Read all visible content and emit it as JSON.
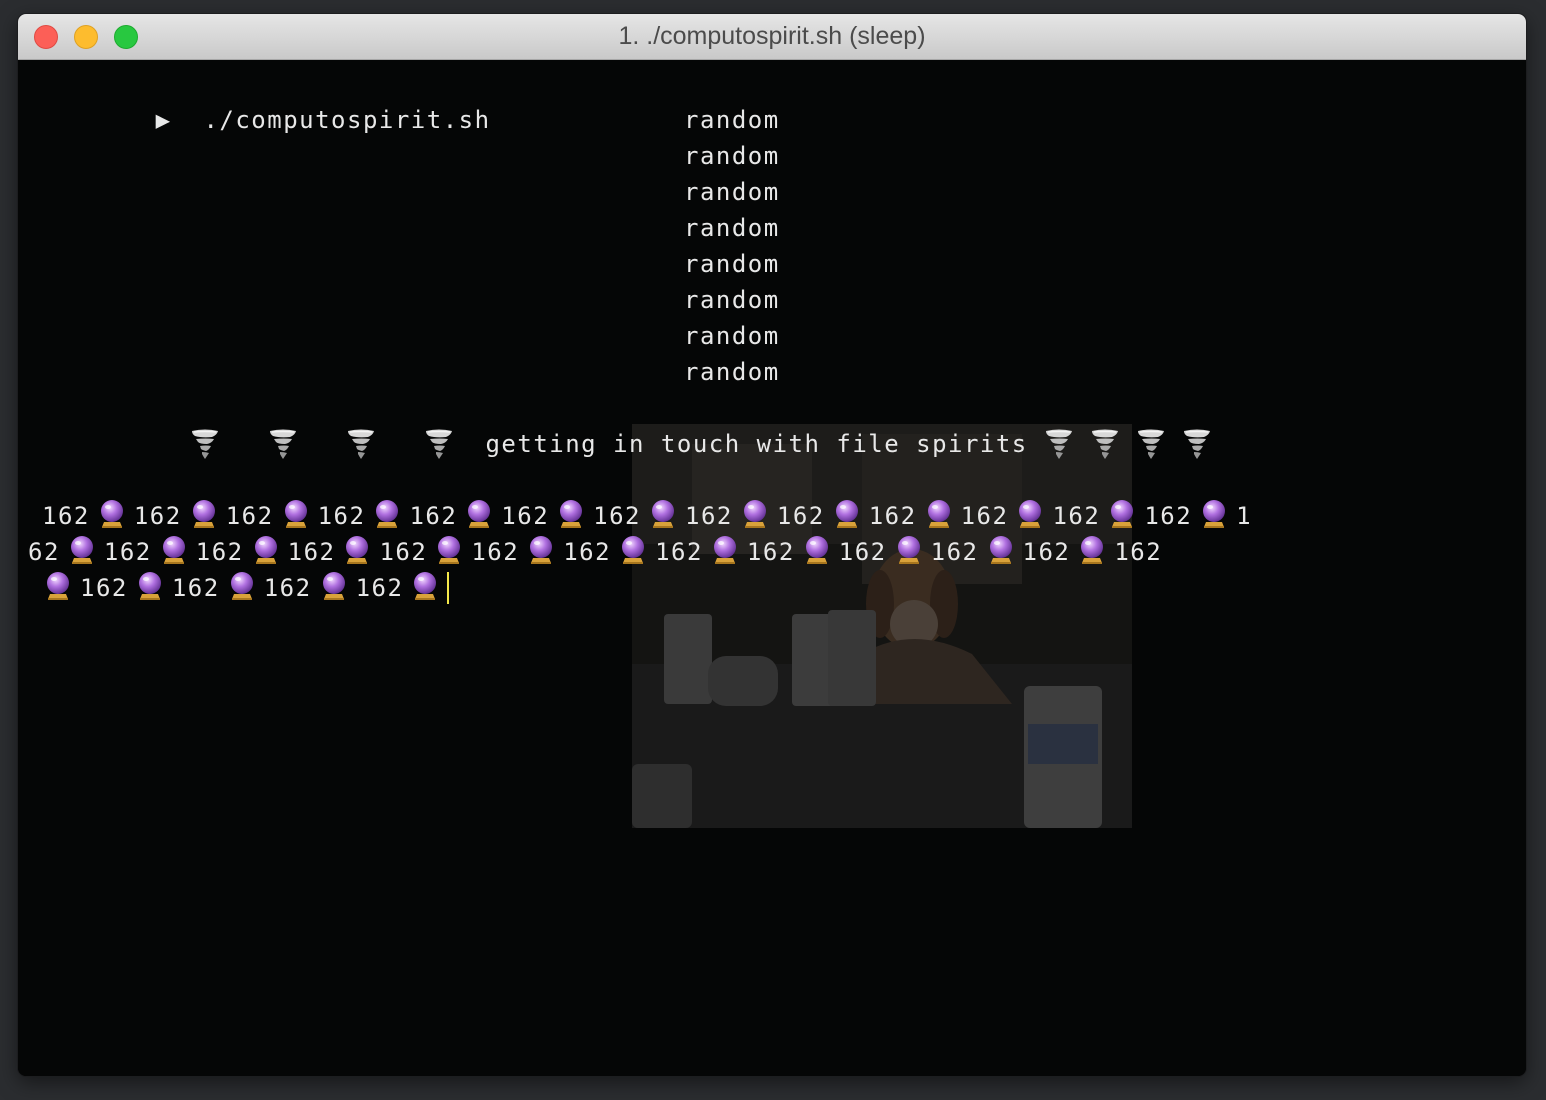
{
  "window": {
    "title": "1. ./computospirit.sh (sleep)"
  },
  "terminal": {
    "prompt_symbol": "▶",
    "command": "./computospirit.sh",
    "random_lines": [
      "random",
      "random",
      "random",
      "random",
      "random",
      "random",
      "random",
      "random"
    ],
    "status_message": "getting in touch with file spirits",
    "left_icon_count": 4,
    "right_icon_count": 4,
    "spirit_icon": "tornado-icon",
    "count_icon": "crystal-ball-icon",
    "count_value": "162",
    "count_repeats": 29,
    "cursor_color": "#f4e84a",
    "background_image": "dog-with-pabst-blue-ribbon-cans"
  }
}
